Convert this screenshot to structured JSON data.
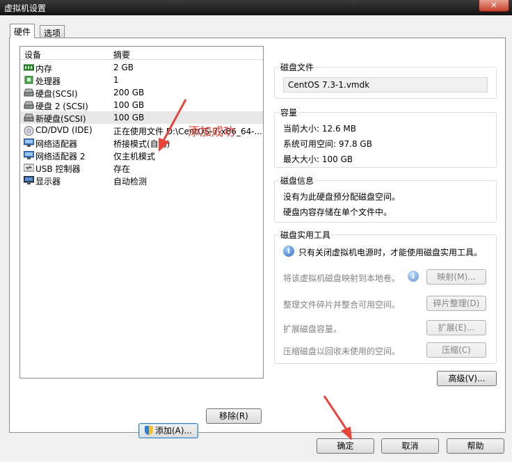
{
  "window": {
    "title": "虚拟机设置",
    "close": "✕"
  },
  "tabs": [
    {
      "label": "硬件"
    },
    {
      "label": "选项"
    }
  ],
  "device_list": {
    "header": {
      "device": "设备",
      "summary": "摘要"
    },
    "rows": [
      {
        "name": "内存",
        "summary": "2 GB",
        "icon": "memory-icon"
      },
      {
        "name": "处理器",
        "summary": "1",
        "icon": "cpu-icon"
      },
      {
        "name": "硬盘(SCSI)",
        "summary": "200 GB",
        "icon": "hdd-icon"
      },
      {
        "name": "硬盘 2 (SCSI)",
        "summary": "100 GB",
        "icon": "hdd-icon"
      },
      {
        "name": "新硬盘(SCSI)",
        "summary": "100 GB",
        "icon": "hdd-icon"
      },
      {
        "name": "CD/DVD (IDE)",
        "summary": "正在使用文件 D:\\CentOS-7-x86_64-...",
        "icon": "cd-icon"
      },
      {
        "name": "网络适配器",
        "summary": "桥接模式(自动)",
        "icon": "network-icon"
      },
      {
        "name": "网络适配器 2",
        "summary": "仅主机模式",
        "icon": "network-icon"
      },
      {
        "name": "USB 控制器",
        "summary": "存在",
        "icon": "usb-icon"
      },
      {
        "name": "显示器",
        "summary": "自动检测",
        "icon": "monitor-icon"
      }
    ],
    "selected_index": 4
  },
  "annotation": "添加成功",
  "list_buttons": {
    "add": "添加(A)...",
    "remove": "移除(R)"
  },
  "disk_file": {
    "title": "磁盘文件",
    "value": "CentOS 7.3-1.vmdk"
  },
  "capacity": {
    "title": "容量",
    "current_size": "当前大小: 12.6 MB",
    "available": "系统可用空间: 97.8 GB",
    "max_size": "最大大小: 100 GB"
  },
  "disk_info": {
    "title": "磁盘信息",
    "line1": "没有为此硬盘预分配磁盘空间。",
    "line2": "硬盘内容存储在单个文件中。"
  },
  "disk_utils": {
    "title": "磁盘实用工具",
    "notice": "只有关闭虚拟机电源时，才能使用磁盘实用工具。",
    "map_label": "将该虚拟机磁盘映射到本地卷。",
    "map_button": "映射(M)...",
    "defrag_label": "整理文件碎片并整合可用空间。",
    "defrag_button": "碎片整理(D)",
    "expand_label": "扩展磁盘容量。",
    "expand_button": "扩展(E)...",
    "compact_label": "压缩磁盘以回收未使用的空间。",
    "compact_button": "压缩(C)"
  },
  "advanced_button": "高级(V)...",
  "footer": {
    "ok": "确定",
    "cancel": "取消",
    "help": "帮助"
  },
  "colors": {
    "annotation": "#e8443a",
    "titlebar": "#1c1c1c"
  }
}
